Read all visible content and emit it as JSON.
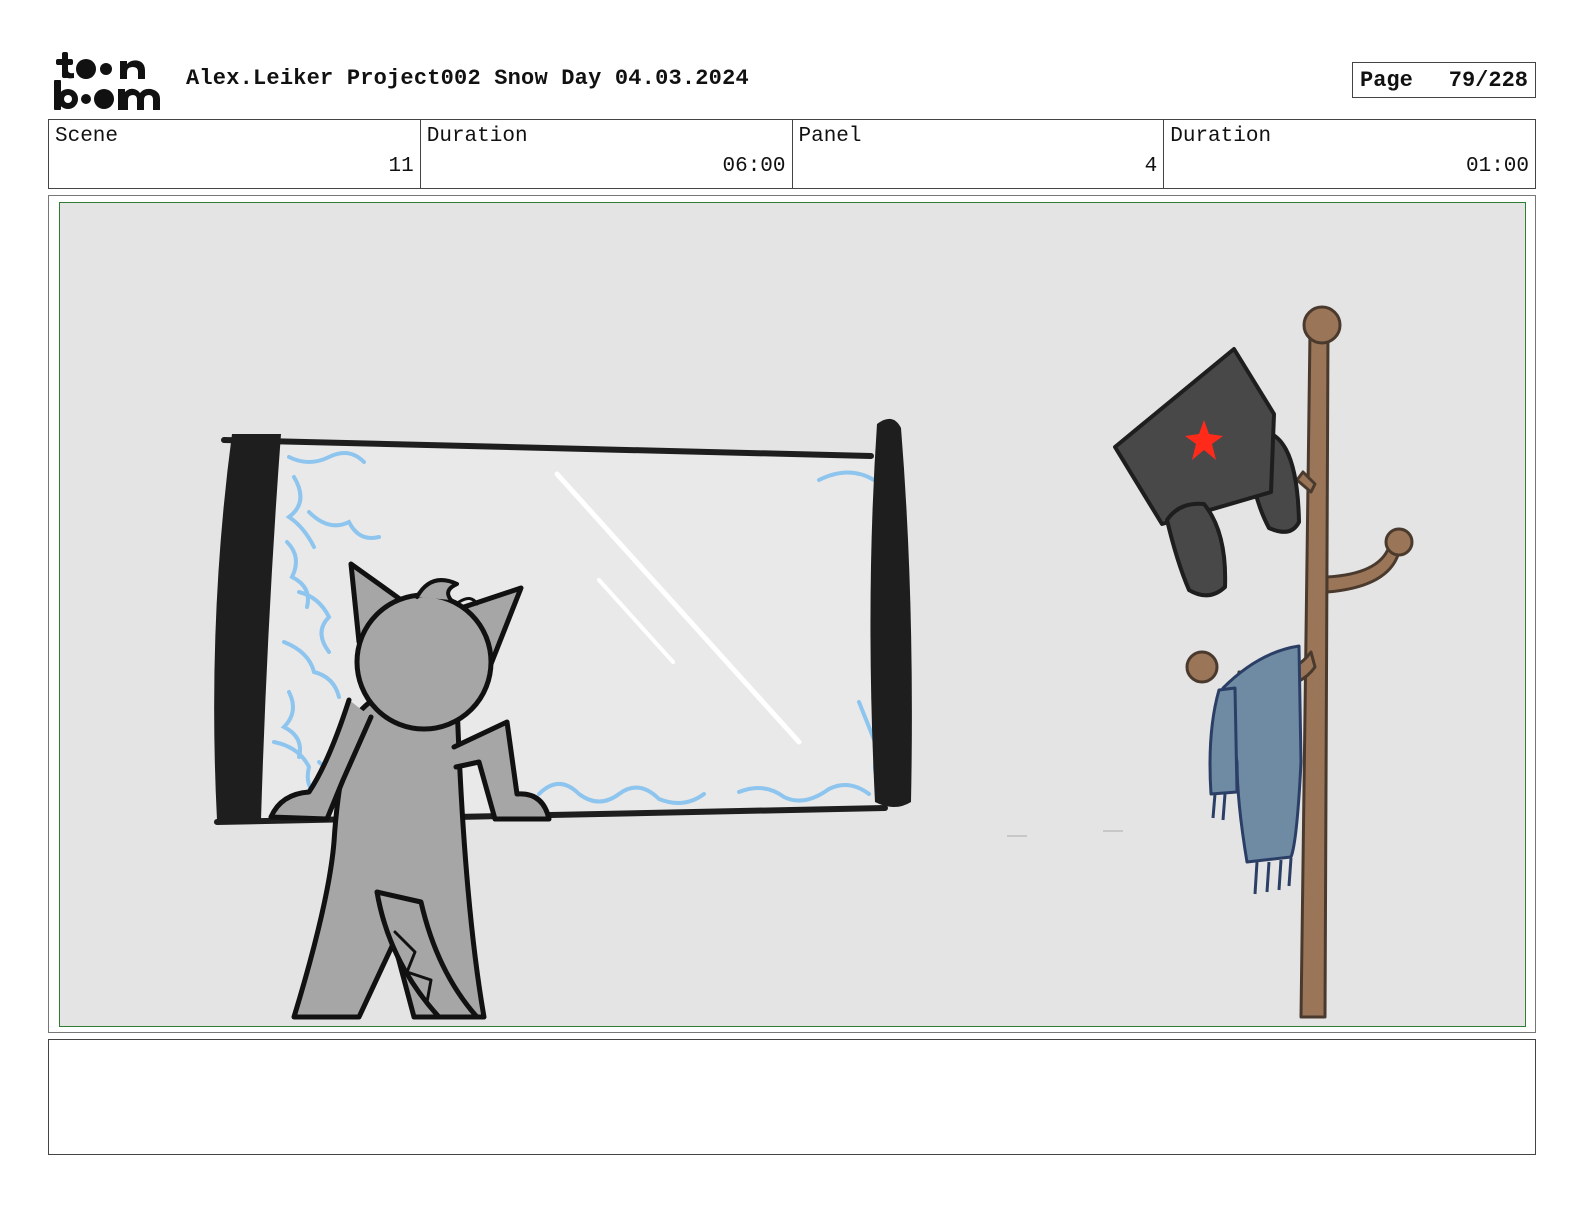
{
  "logo": {
    "line1": "toon",
    "line2": "boom",
    "icon": "toon-boom-logo"
  },
  "header": {
    "title": "Alex.Leiker Project002 Snow Day 04.03.2024",
    "page_label": "Page",
    "page_number": "79/228"
  },
  "info": {
    "scene_label": "Scene",
    "scene_value": "11",
    "scene_duration_label": "Duration",
    "scene_duration_value": "06:00",
    "panel_label": "Panel",
    "panel_value": "4",
    "panel_duration_label": "Duration",
    "panel_duration_value": "01:00"
  },
  "panel": {
    "drawing": "storyboard-sketch",
    "frame_color": "#2e7d32",
    "background_color": "#e4e4e4",
    "elements": [
      "window-with-frost",
      "cat-character",
      "coat-rack",
      "ushanka-hat-with-red-star",
      "blue-scarf"
    ]
  },
  "notes": {
    "text": ""
  }
}
